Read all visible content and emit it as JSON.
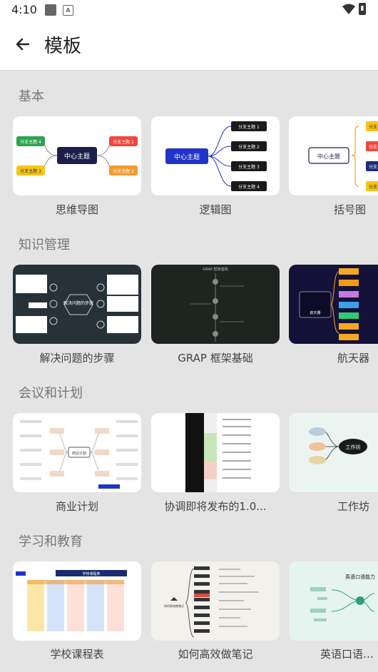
{
  "status": {
    "time": "4:10",
    "battery_glyph": "▮"
  },
  "appbar": {
    "title": "模板",
    "back_icon": "arrow-left-icon"
  },
  "sections": [
    {
      "title": "基本",
      "items": [
        "思维导图",
        "逻辑图",
        "括号图"
      ]
    },
    {
      "title": "知识管理",
      "items": [
        "解决问题的步骤",
        "GRAP 框架基础",
        "航天器"
      ]
    },
    {
      "title": "会议和计划",
      "items": [
        "商业计划",
        "协调即将发布的1.0...",
        "工作坊"
      ]
    },
    {
      "title": "学习和教育",
      "items": [
        "学校课程表",
        "如何高效做笔记",
        "英语口语能力"
      ]
    }
  ],
  "thumbs": {
    "mindmap": {
      "center": "中心主题",
      "branches": [
        "分支主题 4",
        "分支主题 3",
        "分支主题 1",
        "分支主题 2"
      ]
    },
    "logic": {
      "center": "中心主题",
      "branches": [
        "分支主题 1",
        "分支主题 2",
        "分支主题 3",
        "分支主题 4"
      ]
    },
    "bracket": {
      "center": "中心主题",
      "branches": [
        "分支",
        "分支",
        "分支",
        "分支"
      ]
    },
    "steps": {
      "center": "解决问题的步骤"
    },
    "grap": {
      "title": "GRAP 框架基础"
    },
    "space": {
      "center": "航天器"
    },
    "business": {
      "center": "商业计划"
    },
    "workshop": {
      "center": "工作坊"
    },
    "schedule": {
      "title": "学校课程表"
    },
    "notes": {
      "center": "如何高效做笔记"
    },
    "english": {
      "title": "英语口语能力"
    }
  },
  "colors": {
    "green": "#2ea44f",
    "red": "#f0473d",
    "yellow": "#f5c518",
    "orange": "#f29b34",
    "navy": "#1c1f4a",
    "blue": "#2234c8"
  }
}
